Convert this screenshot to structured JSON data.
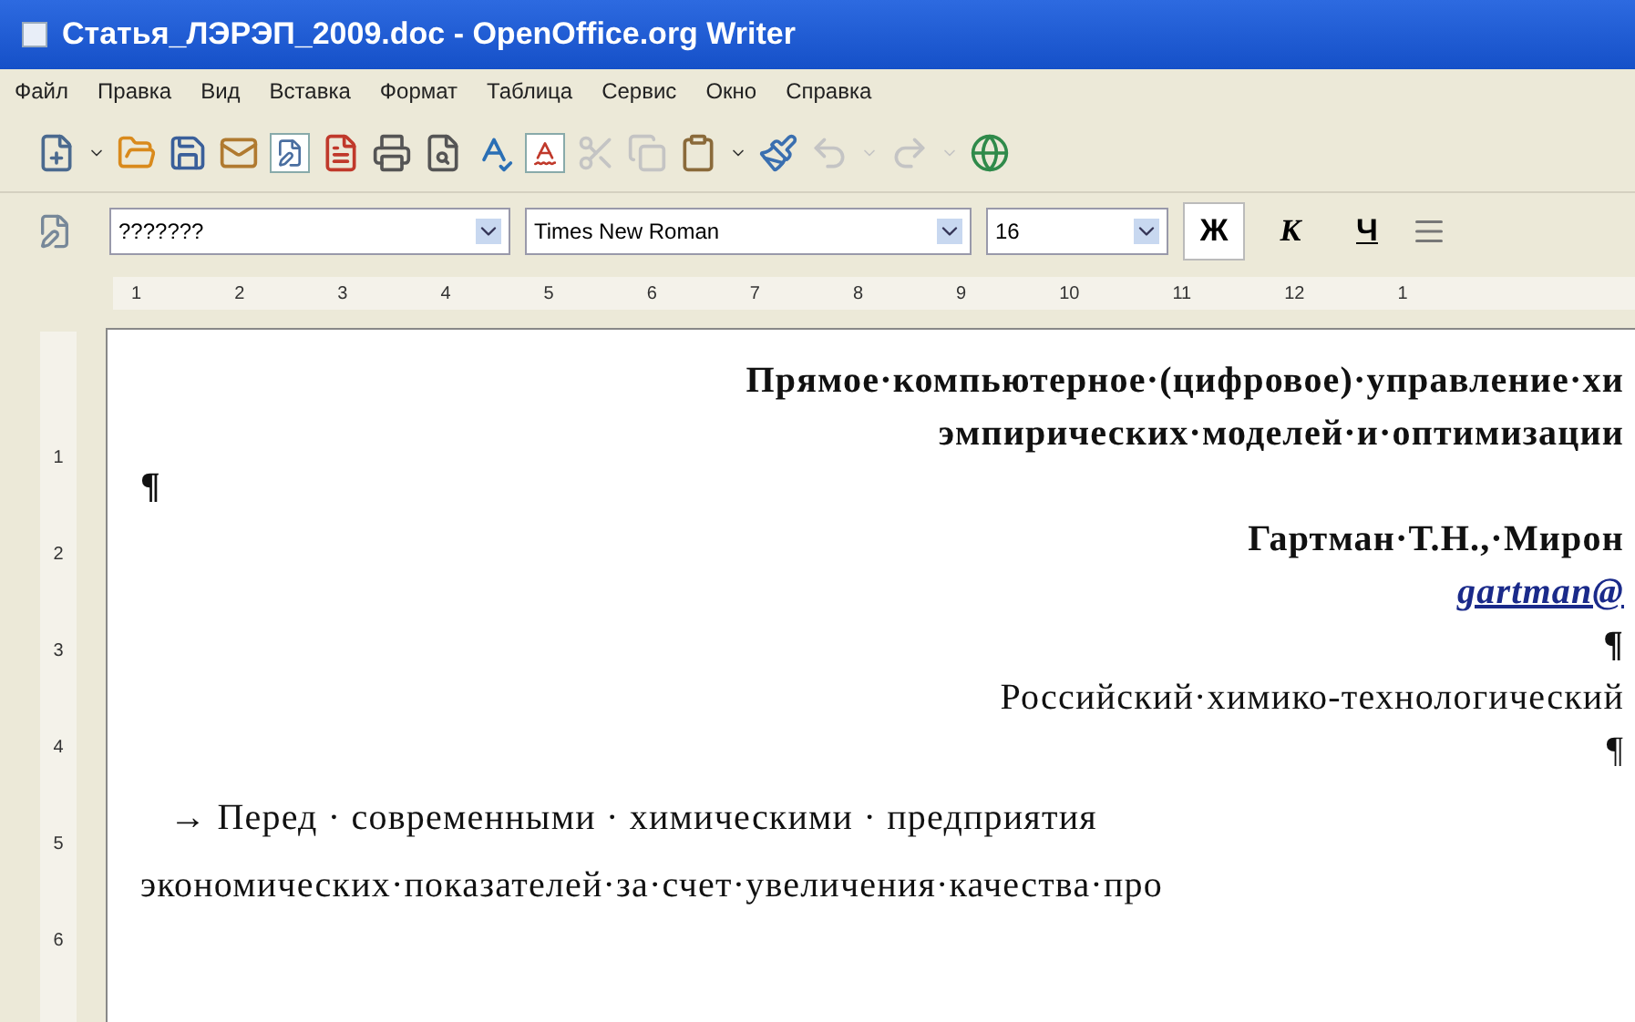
{
  "window": {
    "title": "Статья_ЛЭРЭП_2009.doc - OpenOffice.org Writer"
  },
  "menu": [
    "Файл",
    "Правка",
    "Вид",
    "Вставка",
    "Формат",
    "Таблица",
    "Сервис",
    "Окно",
    "Справка"
  ],
  "toolbar": [
    {
      "kind": "new",
      "disabled": false
    },
    {
      "kind": "dropdown",
      "disabled": false
    },
    {
      "kind": "open",
      "disabled": false
    },
    {
      "kind": "save",
      "disabled": false
    },
    {
      "kind": "mail",
      "disabled": false
    },
    {
      "kind": "edit",
      "disabled": false
    },
    {
      "kind": "pdf",
      "disabled": false
    },
    {
      "kind": "print",
      "disabled": false
    },
    {
      "kind": "preview",
      "disabled": false
    },
    {
      "kind": "spell",
      "disabled": false
    },
    {
      "kind": "autospell",
      "disabled": false
    },
    {
      "kind": "cut",
      "disabled": true
    },
    {
      "kind": "copy",
      "disabled": true
    },
    {
      "kind": "paste",
      "disabled": false
    },
    {
      "kind": "dropdown",
      "disabled": false
    },
    {
      "kind": "brush",
      "disabled": false
    },
    {
      "kind": "undo",
      "disabled": true
    },
    {
      "kind": "dropdown",
      "disabled": true
    },
    {
      "kind": "redo",
      "disabled": true
    },
    {
      "kind": "dropdown",
      "disabled": true
    },
    {
      "kind": "globe",
      "disabled": false
    }
  ],
  "formatting": {
    "style": "???????",
    "font": "Times New Roman",
    "size": "16",
    "buttons": [
      {
        "label": "Ж",
        "kind": "bold"
      },
      {
        "label": "К",
        "kind": "italic"
      },
      {
        "label": "Ч",
        "kind": "underline"
      }
    ]
  },
  "ruler": [
    "1",
    "2",
    "3",
    "4",
    "5",
    "6",
    "7",
    "8",
    "9",
    "10",
    "11",
    "12",
    "1"
  ],
  "vruler": [
    "1",
    "2",
    "3",
    "4",
    "5",
    "6"
  ],
  "document": [
    {
      "text": "Прямое·компьютерное·(цифровое)·управление·хи",
      "bold": true,
      "italic": false,
      "kind": "heading"
    },
    {
      "text": "эмпирических·моделей·и·оптимизации",
      "bold": true,
      "italic": false,
      "kind": "heading"
    },
    {
      "text": "¶",
      "bold": true,
      "italic": false,
      "kind": "mark"
    },
    {
      "text": "Гартман·Т.Н.,·Мирон",
      "bold": true,
      "italic": false,
      "kind": "heading"
    },
    {
      "text": "gartman@",
      "bold": true,
      "italic": true,
      "kind": "link"
    },
    {
      "text": "¶",
      "bold": true,
      "italic": false,
      "kind": "heading"
    },
    {
      "text": "Российский·химико-технологический",
      "bold": false,
      "italic": false,
      "kind": "heading"
    },
    {
      "text": "¶",
      "bold": false,
      "italic": false,
      "kind": "heading"
    },
    {
      "text": "→   Перед · современными · химическими · предприятия",
      "bold": false,
      "italic": false,
      "kind": "indent"
    },
    {
      "text": "экономических·показателей·за·счет·увеличения·качества·про",
      "bold": false,
      "italic": false,
      "kind": "body"
    }
  ]
}
